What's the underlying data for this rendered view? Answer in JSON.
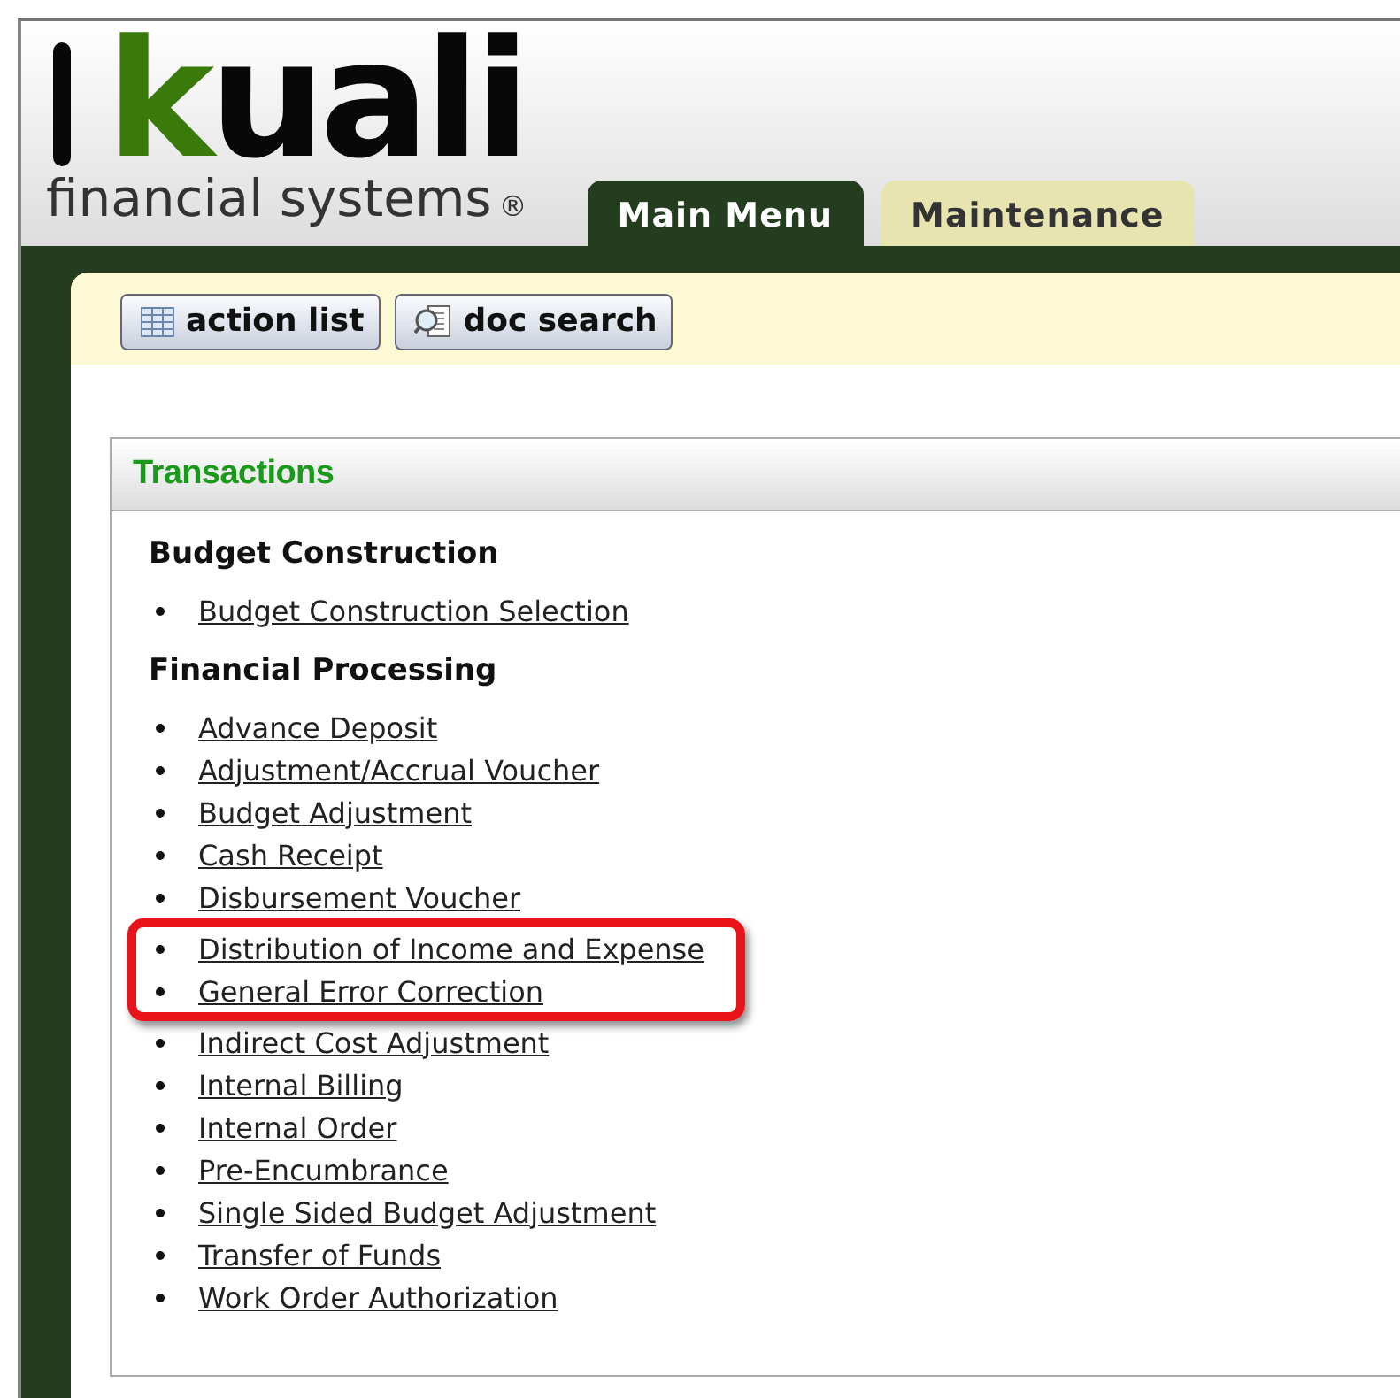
{
  "logo": {
    "wordmark": "kuali",
    "tagline": "financial systems",
    "registered": "®"
  },
  "tabs": [
    {
      "label": "Main Menu",
      "selected": true
    },
    {
      "label": "Maintenance",
      "selected": false
    }
  ],
  "toolbar": [
    {
      "label": "action list",
      "kind": "list"
    },
    {
      "label": "doc search",
      "kind": "search"
    }
  ],
  "panel": {
    "title": "Transactions",
    "sections": [
      {
        "heading": "Budget Construction",
        "links": [
          {
            "label": "Budget Construction Selection",
            "highlighted": false
          }
        ]
      },
      {
        "heading": "Financial Processing",
        "links": [
          {
            "label": "Advance Deposit",
            "highlighted": false
          },
          {
            "label": "Adjustment/Accrual Voucher",
            "highlighted": false
          },
          {
            "label": "Budget Adjustment",
            "highlighted": false
          },
          {
            "label": "Cash Receipt",
            "highlighted": false
          },
          {
            "label": "Disbursement Voucher",
            "highlighted": false
          },
          {
            "label": "Distribution of Income and Expense",
            "highlighted": true
          },
          {
            "label": "General Error Correction",
            "highlighted": true
          },
          {
            "label": "Indirect Cost Adjustment",
            "highlighted": false
          },
          {
            "label": "Internal Billing",
            "highlighted": false
          },
          {
            "label": "Internal Order",
            "highlighted": false
          },
          {
            "label": "Pre-Encumbrance",
            "highlighted": false
          },
          {
            "label": "Single Sided Budget Adjustment",
            "highlighted": false
          },
          {
            "label": "Transfer of Funds",
            "highlighted": false
          },
          {
            "label": "Work Order Authorization",
            "highlighted": false
          }
        ]
      }
    ]
  }
}
